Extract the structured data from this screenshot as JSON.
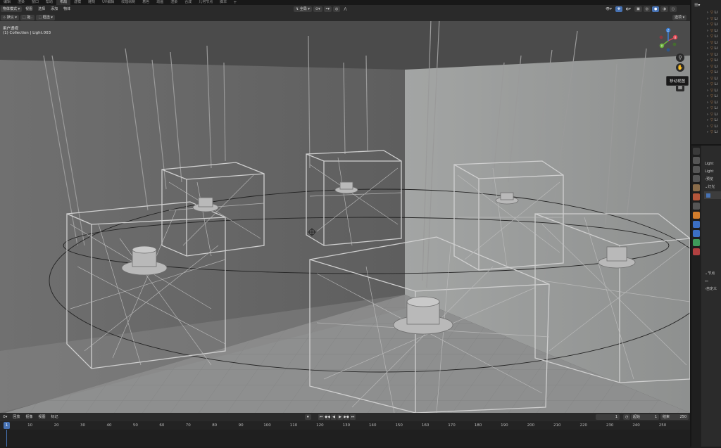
{
  "topbar": {
    "workspaces": [
      "编辑",
      "渲染",
      "窗口",
      "帮助",
      "布局",
      "建模",
      "雕刻",
      "UV编辑",
      "纹理绘制",
      "着色",
      "动画",
      "渲染",
      "合成",
      "几何节点",
      "脚本"
    ],
    "active_index": 4,
    "plus": "+"
  },
  "viewport_header": {
    "mode": "物体模式",
    "menus": [
      "视图",
      "选择",
      "添加",
      "物体"
    ],
    "transform_orientation": "全局",
    "options": "选项"
  },
  "viewport_header2": {
    "default": "默认",
    "drag": "拖..",
    "select_box": "框选"
  },
  "viewport": {
    "view_name": "用户透视",
    "collection_info": "(1) Collection | Light.003",
    "tooltip": "移动视图",
    "gizmo_axes": {
      "x": "X",
      "y": "Y",
      "z": "Z"
    }
  },
  "timeline": {
    "menus": [
      "回放",
      "抠像",
      "视图",
      "标记"
    ],
    "current_frame": "1",
    "start_label": "起始",
    "start_value": "1",
    "end_label": "结束",
    "end_value": "250",
    "ticks": [
      1,
      10,
      20,
      30,
      40,
      50,
      60,
      70,
      80,
      90,
      100,
      110,
      120,
      130,
      140,
      150,
      160,
      170,
      180,
      190,
      200,
      210,
      220,
      230,
      240,
      250
    ]
  },
  "outliner": {
    "rows": [
      "Li",
      "Li",
      "Li",
      "Li",
      "Li",
      "Li",
      "Li",
      "Li",
      "Li",
      "Li",
      "Li",
      "Li",
      "Li",
      "Li",
      "Li",
      "Li",
      "Li",
      "Li",
      "Li",
      "Li",
      "Li"
    ]
  },
  "properties": {
    "object_name": "Light",
    "data_name": "Light",
    "preview": "预览",
    "light": "灯光",
    "nodes": "节点",
    "custom_props": "自定义"
  },
  "colors": {
    "accent": "#4772b3",
    "panel": "#2a2a2a",
    "wall_left": "#6d6d6d",
    "wall_right": "#9a9c9b",
    "floor": "#8f9090",
    "ceiling": "#4a4a4a"
  }
}
